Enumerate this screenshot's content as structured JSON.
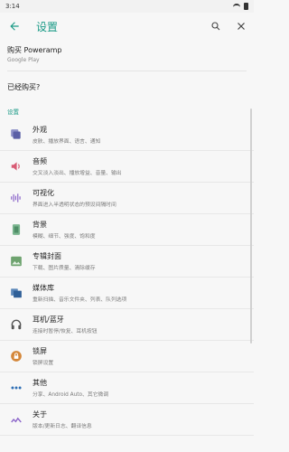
{
  "status": {
    "time": "3:14"
  },
  "header": {
    "title": "设置"
  },
  "purchase": {
    "title": "购买 Poweramp",
    "subtitle": "Google Play"
  },
  "restore": {
    "label": "已经购买?"
  },
  "section": {
    "label": "设置"
  },
  "settings": [
    {
      "title": "外观",
      "subtitle": "皮肤、播放界面、语言、通知",
      "icon": "appearance-icon"
    },
    {
      "title": "音频",
      "subtitle": "交叉淡入淡出、播放增益、音量、输出",
      "icon": "audio-icon"
    },
    {
      "title": "可视化",
      "subtitle": "界面进入半透明状态的预设间隔时间",
      "icon": "visualization-icon"
    },
    {
      "title": "背景",
      "subtitle": "模糊、细节、强度、饱和度",
      "icon": "background-icon"
    },
    {
      "title": "专辑封面",
      "subtitle": "下载、图片质量、清除缓存",
      "icon": "album-art-icon"
    },
    {
      "title": "媒体库",
      "subtitle": "重新扫描、音乐文件夹、列表、队列选项",
      "icon": "library-icon"
    },
    {
      "title": "耳机/蓝牙",
      "subtitle": "连接时暂停/恢复、耳机按钮",
      "icon": "headset-icon"
    },
    {
      "title": "锁屏",
      "subtitle": "锁屏设置",
      "icon": "lock-screen-icon"
    },
    {
      "title": "其他",
      "subtitle": "分享、Android Auto、其它微调",
      "icon": "misc-icon"
    },
    {
      "title": "关于",
      "subtitle": "版本/更新日志、翻译信息",
      "icon": "about-icon"
    }
  ],
  "colors": {
    "accent": "#1a9a86"
  }
}
